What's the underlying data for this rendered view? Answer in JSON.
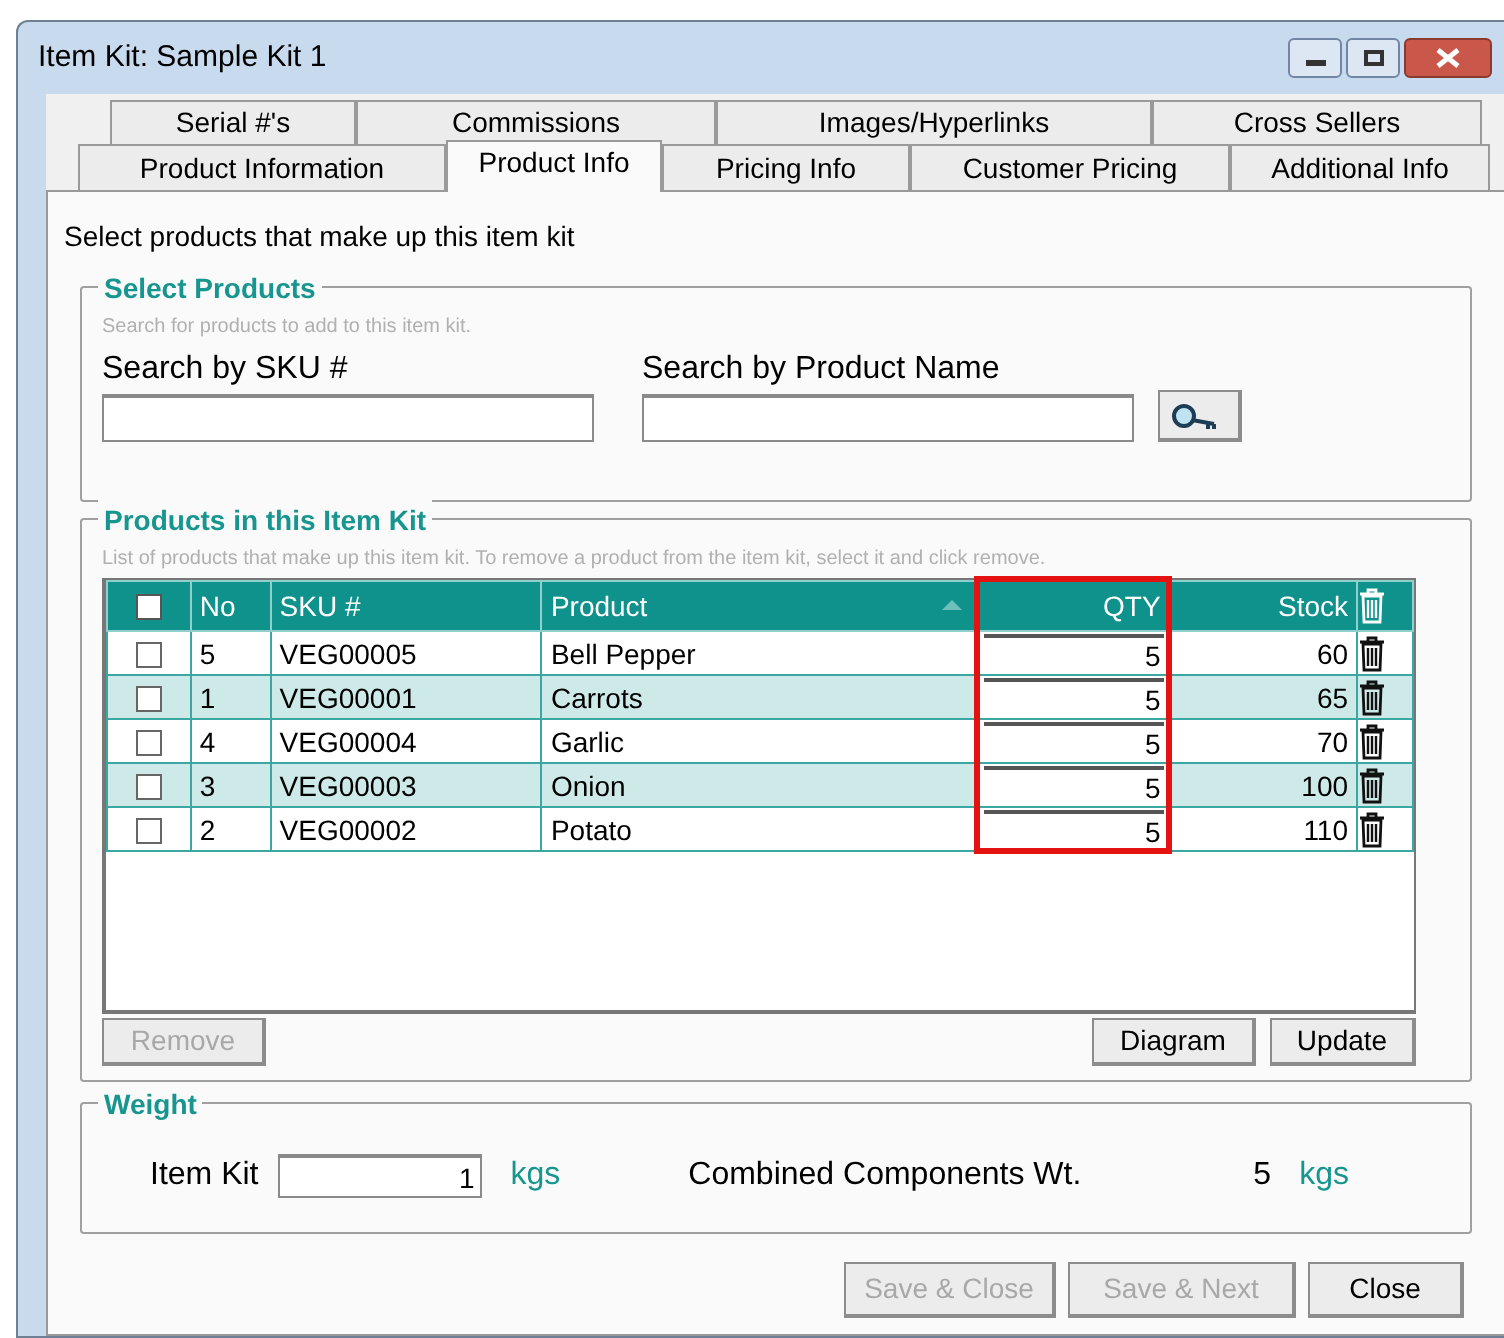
{
  "window": {
    "title": "Item Kit: Sample Kit 1"
  },
  "tabs_back": [
    {
      "label": "Serial #'s",
      "selected": false
    },
    {
      "label": "Commissions",
      "selected": false
    },
    {
      "label": "Images/Hyperlinks",
      "selected": false
    },
    {
      "label": "Cross Sellers",
      "selected": false
    }
  ],
  "tabs_front": [
    {
      "label": "Product Information",
      "selected": false
    },
    {
      "label": "Product Info",
      "selected": true
    },
    {
      "label": "Pricing Info",
      "selected": false
    },
    {
      "label": "Customer Pricing",
      "selected": false
    },
    {
      "label": "Additional Info",
      "selected": false
    }
  ],
  "intro": "Select products that make up this item kit",
  "select_products": {
    "title": "Select Products",
    "hint": "Search for products to add to this item kit.",
    "sku_label": "Search by SKU #",
    "name_label": "Search by Product Name"
  },
  "products_in_kit": {
    "title": "Products in this Item Kit",
    "hint": "List of products that make up this item kit. To remove a product from the item kit, select it and click remove.",
    "header_checked": false,
    "columns": [
      {
        "label": "No"
      },
      {
        "label": "SKU #"
      },
      {
        "label": "Product",
        "sorted": true
      },
      {
        "label": "QTY",
        "highlighted": true
      },
      {
        "label": "Stock"
      }
    ],
    "rows": [
      {
        "checked": false,
        "no": "5",
        "sku": "VEG00005",
        "product": "Bell Pepper",
        "qty": "5",
        "stock": "60"
      },
      {
        "checked": false,
        "no": "1",
        "sku": "VEG00001",
        "product": "Carrots",
        "qty": "5",
        "stock": "65"
      },
      {
        "checked": false,
        "no": "4",
        "sku": "VEG00004",
        "product": "Garlic",
        "qty": "5",
        "stock": "70"
      },
      {
        "checked": false,
        "no": "3",
        "sku": "VEG00003",
        "product": "Onion",
        "qty": "5",
        "stock": "100"
      },
      {
        "checked": false,
        "no": "2",
        "sku": "VEG00002",
        "product": "Potato",
        "qty": "5",
        "stock": "110"
      }
    ],
    "buttons": [
      {
        "label": "Remove",
        "disabled": true
      },
      {
        "label": "Diagram",
        "disabled": false
      },
      {
        "label": "Update",
        "disabled": false
      }
    ]
  },
  "weight": {
    "title": "Weight",
    "item_kit_label": "Item Kit",
    "item_kit_value": "1",
    "unit_1": "kgs",
    "combined_label": "Combined Components Wt.",
    "combined_value": "5",
    "unit_2": "kgs"
  },
  "footer_buttons": [
    {
      "label": "Save & Close",
      "disabled": true
    },
    {
      "label": "Save & Next",
      "disabled": true
    },
    {
      "label": "Close",
      "disabled": false
    }
  ]
}
